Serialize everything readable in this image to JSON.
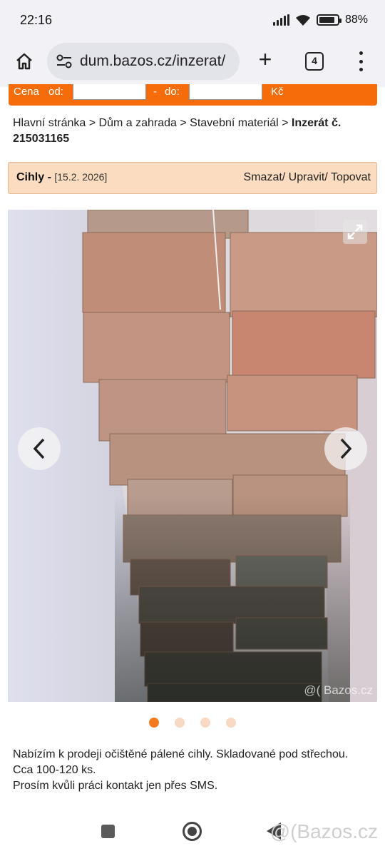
{
  "status_bar": {
    "time": "22:16",
    "battery": "88%",
    "battery_level": 0.88
  },
  "browser": {
    "url": "dum.bazos.cz/inzerat/",
    "tab_count": "4"
  },
  "search_strip": {
    "price_label": "Cena",
    "from_label": "od:",
    "dash": "-",
    "to_label": "do:",
    "currency": "Kč"
  },
  "breadcrumb": {
    "items": [
      "Hlavní stránka",
      "Dům a zahrada",
      "Stavební materiál"
    ],
    "separator": ">",
    "current": "Inzerát č. 215031165"
  },
  "listing": {
    "title": "Cihly",
    "date": "[15.2. 2026]",
    "actions": "Smazat/ Upravit/ Topovat"
  },
  "gallery": {
    "image_count": 4,
    "active_index": 0,
    "watermark": "@( Bazos.cz"
  },
  "description": {
    "lines": [
      "Nabízím k prodeji očištěné pálené cihly. Skladované pod střechou.",
      "Cca 100-120 ks.",
      "Prosím kvůli práci kontakt jen přes SMS."
    ]
  },
  "bottom_watermark": "@(Bazos.cz",
  "colors": {
    "accent": "#f66c0b",
    "header_bg": "#fcdcc0",
    "dot_active": "#f47a22",
    "dot_inactive": "#f9d9c3"
  }
}
